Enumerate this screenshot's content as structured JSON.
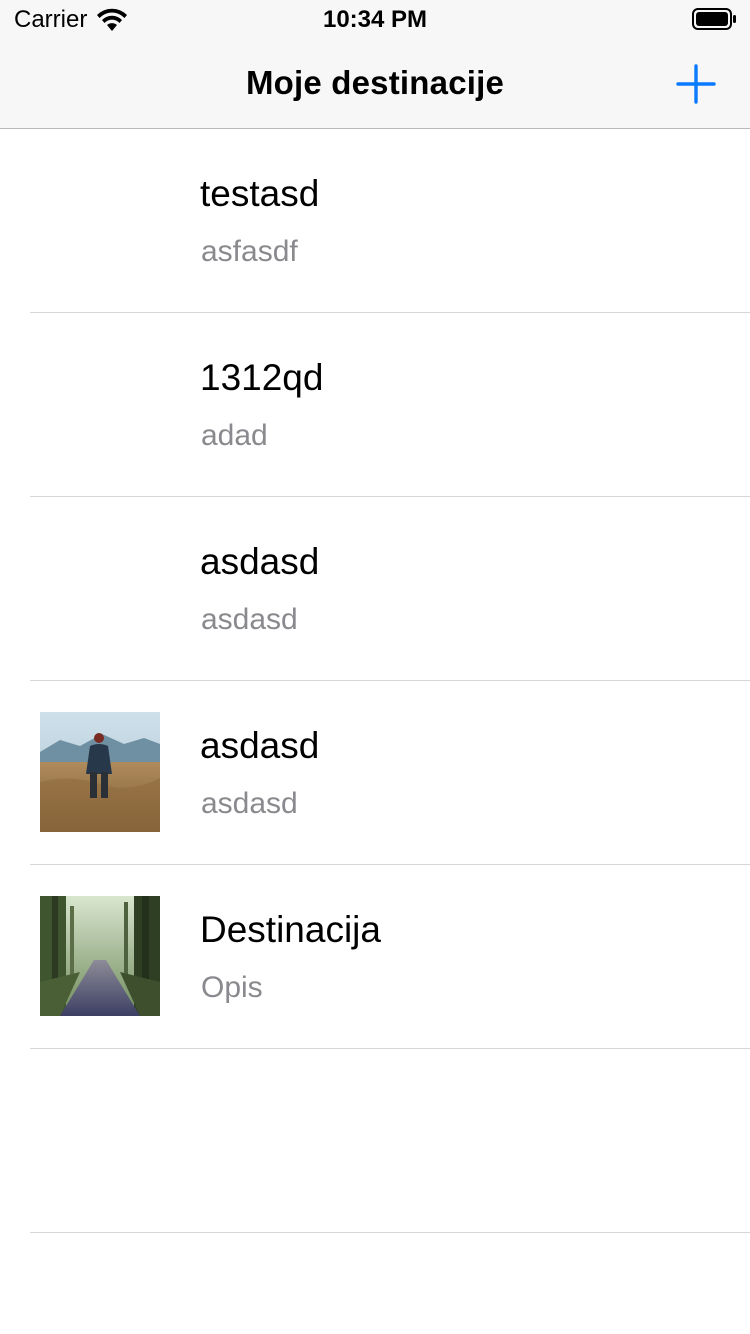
{
  "status_bar": {
    "carrier": "Carrier",
    "time": "10:34 PM",
    "icons": [
      "wifi-icon",
      "battery-icon"
    ]
  },
  "nav": {
    "title": "Moje destinacije",
    "add_icon": "plus-icon",
    "accent_color": "#0a7aff"
  },
  "destinations": [
    {
      "title": "testasd",
      "subtitle": "asfasdf",
      "thumbnail": null
    },
    {
      "title": "1312qd",
      "subtitle": "adad",
      "thumbnail": null
    },
    {
      "title": "asdasd",
      "subtitle": "asdasd",
      "thumbnail": null
    },
    {
      "title": "asdasd",
      "subtitle": "asdasd",
      "thumbnail": "person-in-field-photo"
    },
    {
      "title": "Destinacija",
      "subtitle": "Opis",
      "thumbnail": "forest-road-photo"
    }
  ]
}
